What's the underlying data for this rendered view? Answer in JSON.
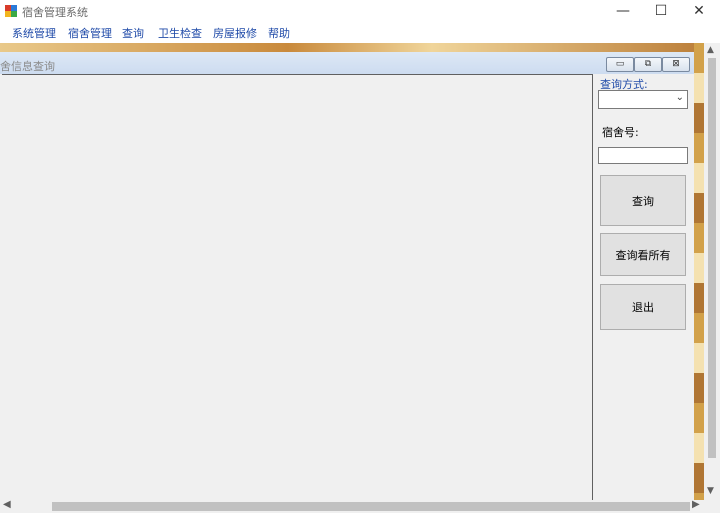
{
  "window": {
    "title": "宿舍管理系统",
    "minimize_glyph": "—",
    "maximize_glyph": "☐",
    "close_glyph": "✕"
  },
  "menu": {
    "items": [
      "系统管理",
      "宿舍管理",
      "查询",
      "卫生检查",
      "房屋报修",
      "帮助"
    ]
  },
  "child": {
    "title": "舍信息查询",
    "min_glyph": "▭",
    "restore_glyph": "⧉",
    "close_glyph": "⊠"
  },
  "panel": {
    "query_mode_label": "查询方式:",
    "query_mode_value": "",
    "room_label": "宿舍号:",
    "room_value": "",
    "query_button": "查询",
    "query_all_button": "查询看所有",
    "exit_button": "退出"
  },
  "scroll": {
    "left_arrow": "◀",
    "right_arrow": "▶",
    "up_arrow": "▲",
    "down_arrow": "▼"
  }
}
